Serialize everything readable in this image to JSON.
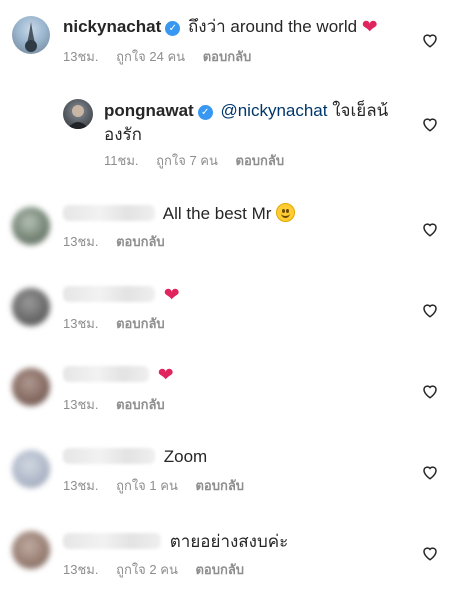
{
  "comments": [
    {
      "username": "nickynachat",
      "verified": true,
      "text": "ถึงว่า around the world",
      "emoji": "heart",
      "time": "13ชม.",
      "likes": "ถูกใจ 24 คน",
      "reply_label": "ตอบกลับ",
      "avatar_colors": [
        "#9bb6cf",
        "#6b7e8f"
      ]
    },
    {
      "username": "pongnawat",
      "verified": true,
      "mention": "@nickynachat",
      "text": "ใจเย็ลน้องรัก",
      "time": "11ชม.",
      "likes": "ถูกใจ 7 คน",
      "reply_label": "ตอบกลับ",
      "avatar_colors": [
        "#5a5f66",
        "#2f3338"
      ]
    },
    {
      "text": "All the best Mr",
      "emoji": "smile",
      "time": "13ชม.",
      "reply_label": "ตอบกลับ",
      "avatar_colors": [
        "#7a8a7a",
        "#4c544c"
      ]
    },
    {
      "emoji": "heart",
      "time": "13ชม.",
      "reply_label": "ตอบกลับ",
      "avatar_colors": [
        "#6e6e6e",
        "#3e3e3e"
      ]
    },
    {
      "emoji": "heart",
      "time": "13ชม.",
      "reply_label": "ตอบกลับ",
      "avatar_colors": [
        "#8a6f66",
        "#54423d"
      ]
    },
    {
      "text": "Zoom",
      "time": "13ชม.",
      "likes": "ถูกใจ 1 คน",
      "reply_label": "ตอบกลับ",
      "avatar_colors": [
        "#b3bccc",
        "#8a93a6"
      ]
    },
    {
      "text": "ตายอย่างสงบค่ะ",
      "time": "13ชม.",
      "likes": "ถูกใจ 2 คน",
      "reply_label": "ตอบกลับ",
      "avatar_colors": [
        "#9c8378",
        "#6a554c"
      ]
    }
  ],
  "colors": {
    "verified": "#3897f0",
    "mention": "#00376b",
    "heart_emoji": "#e0245e",
    "meta_text": "#8e8e8e"
  }
}
